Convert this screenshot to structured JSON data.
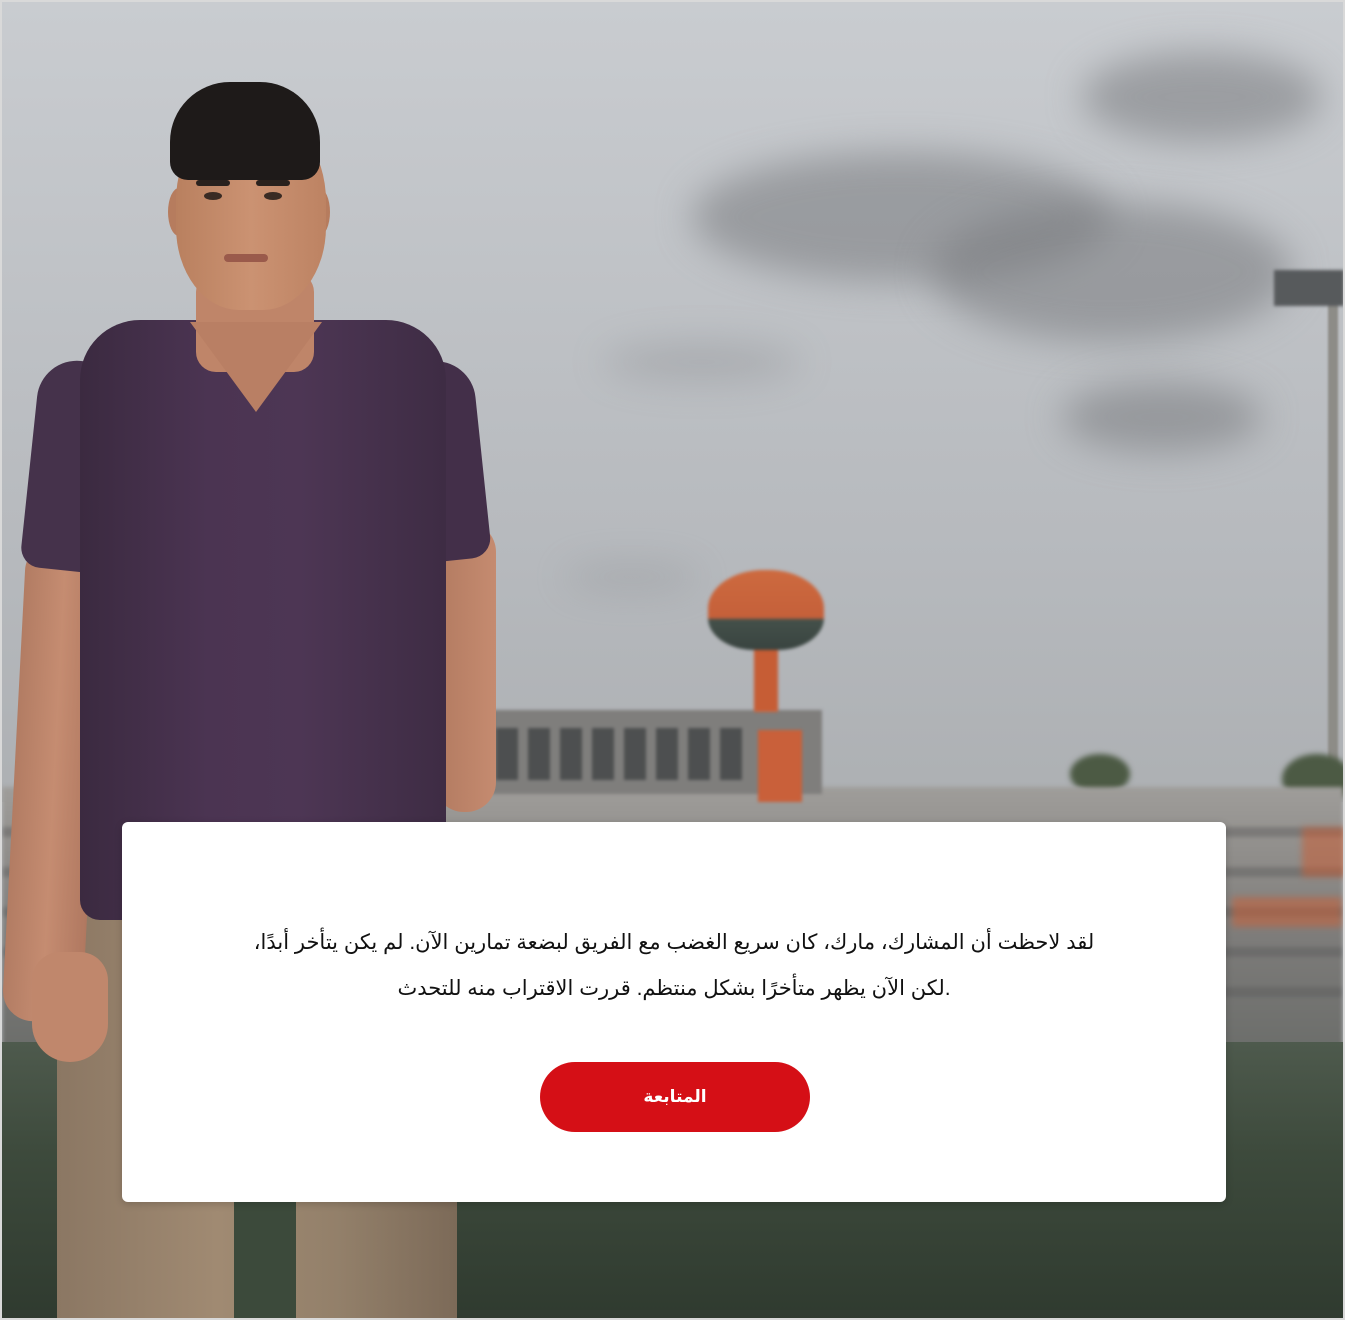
{
  "dialog": {
    "line1": "لقد لاحظت أن المشارك، مارك، كان سريع الغضب مع الفريق لبضعة تمارين الآن. لم يكن يتأخر أبدًا،",
    "line2": ".لكن الآن يظهر متأخرًا بشكل منتظم. قررت الاقتراب منه للتحدث",
    "continue_label": "المتابعة"
  },
  "colors": {
    "accent": "#d50f16",
    "dialog_background": "#ffffff",
    "text": "#111111"
  },
  "background": {
    "scene": "stadium-background",
    "character": "mark-character"
  }
}
